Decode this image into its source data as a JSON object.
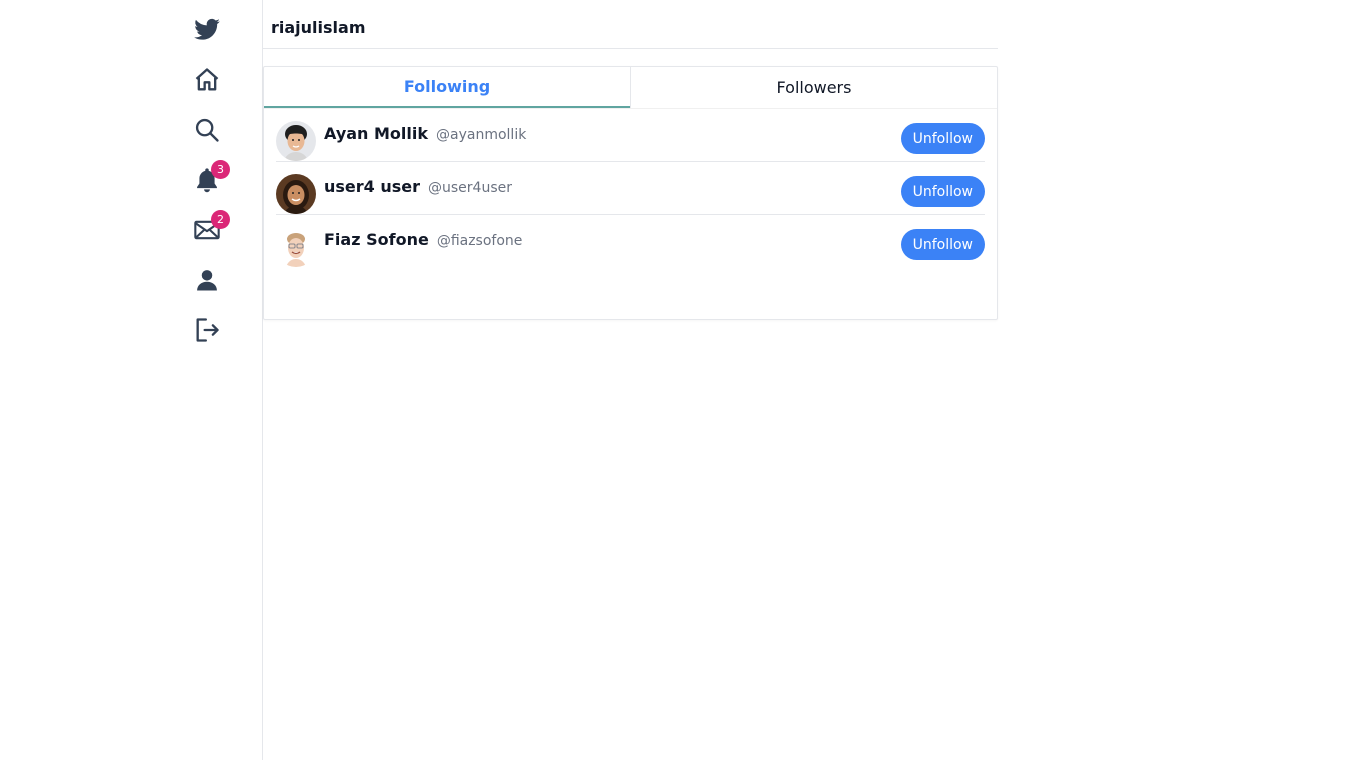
{
  "sidebar": {
    "items": [
      {
        "icon": "twitter-logo-icon"
      },
      {
        "icon": "home-icon"
      },
      {
        "icon": "search-icon"
      },
      {
        "icon": "bell-icon",
        "badge": "3"
      },
      {
        "icon": "mail-icon",
        "badge": "2"
      },
      {
        "icon": "user-icon"
      },
      {
        "icon": "logout-icon"
      }
    ]
  },
  "header": {
    "username": "riajulislam"
  },
  "tabs": [
    {
      "label": "Following",
      "active": true
    },
    {
      "label": "Followers",
      "active": false
    }
  ],
  "following": [
    {
      "name": "Ayan Mollik",
      "handle": "@ayanmollik",
      "button": "Unfollow"
    },
    {
      "name": "user4 user",
      "handle": "@user4user",
      "button": "Unfollow"
    },
    {
      "name": "Fiaz Sofone",
      "handle": "@fiazsofone",
      "button": "Unfollow"
    }
  ],
  "colors": {
    "accent": "#3b82f6",
    "badge": "#db2777",
    "icon": "#334155"
  }
}
